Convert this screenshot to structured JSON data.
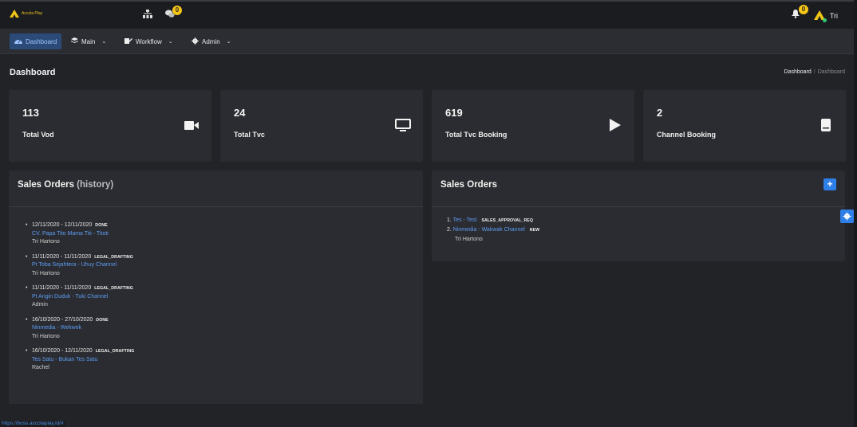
{
  "app": {
    "logo_text": "Accola Play",
    "colors": {
      "accent": "#2f7fe8",
      "badge": "#f5c518",
      "link": "#5b9cf0",
      "bg": "#222327",
      "card": "#2b2c31"
    }
  },
  "topbar": {
    "apps_icon": "sitemap-icon",
    "chat_icon": "comments-icon",
    "chat_badge": "0",
    "bell_icon": "bell-icon",
    "bell_badge": "0",
    "user_name": "Tri"
  },
  "nav": {
    "items": [
      {
        "label": "Dashboard",
        "icon": "tachometer-icon"
      },
      {
        "label": "Main",
        "icon": "layers-icon"
      },
      {
        "label": "Workflow",
        "icon": "edit-icon"
      },
      {
        "label": "Admin",
        "icon": "gear-icon"
      }
    ]
  },
  "page": {
    "title": "Dashboard",
    "breadcrumb": [
      "Dashboard",
      "/",
      "Dashboard"
    ]
  },
  "stats": [
    {
      "value": "113",
      "label": "Total Vod",
      "icon": "video-camera-icon"
    },
    {
      "value": "24",
      "label": "Total Tvc",
      "icon": "desktop-icon"
    },
    {
      "value": "619",
      "label": "Total Tvc Booking",
      "icon": "play-icon"
    },
    {
      "value": "2",
      "label": "Channel Booking",
      "icon": "book-icon"
    }
  ],
  "history": {
    "title": "Sales Orders",
    "title_muted": "(history)",
    "items": [
      {
        "dates": "12/11/2020 - 12/11/2020",
        "status": "DONE",
        "link": "CV. Papa Tito Mama Titi - Titoti",
        "person": "Tri Hartono"
      },
      {
        "dates": "11/11/2020 - 11/11/2020",
        "status": "LEGAL_DRAFTING",
        "link": "Pt Toba Sejahtera - Uhuy Channel",
        "person": "Tri Hartono"
      },
      {
        "dates": "11/11/2020 - 11/11/2020",
        "status": "LEGAL_DRAFTING",
        "link": "Pt Angin Duduk - Tuki Channel",
        "person": "Admin"
      },
      {
        "dates": "16/10/2020 - 27/10/2020",
        "status": "DONE",
        "link": "Ninmedia - Wekwek",
        "person": "Tri Hartono"
      },
      {
        "dates": "16/10/2020 - 12/11/2020",
        "status": "LEGAL_DRAFTING",
        "link": "Tes Satu - Bukan Tes Satu",
        "person": "Rachel"
      }
    ]
  },
  "orders": {
    "title": "Sales Orders",
    "add_label": "+",
    "items": [
      {
        "num": "1.",
        "link": "Tes - Test",
        "status": "SALES_APPROVAL_REQ"
      },
      {
        "num": "2.",
        "link": "Ninmedia - Wakwak Channel",
        "status": "NEW"
      }
    ],
    "person": "Tri Hartono"
  },
  "status_bar": {
    "url": "https://boss.accolaplay.id/#"
  }
}
